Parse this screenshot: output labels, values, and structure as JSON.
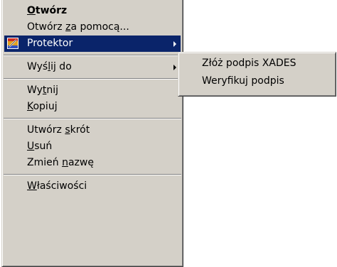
{
  "menu": {
    "items": [
      {
        "pre": "",
        "key": "O",
        "post": "twórz",
        "bold": true
      },
      {
        "pre": "Otwórz ",
        "key": "z",
        "post": "a pomocą..."
      },
      {
        "pre": "",
        "key": "",
        "post": "Protektor",
        "selected": true,
        "icon": "protektor-app-icon"
      },
      {
        "pre": "Wyś",
        "key": "l",
        "post": "ij do"
      },
      {
        "pre": "Wy",
        "key": "t",
        "post": "nij"
      },
      {
        "pre": "",
        "key": "K",
        "post": "opiuj"
      },
      {
        "pre": "Utwórz ",
        "key": "s",
        "post": "krót"
      },
      {
        "pre": "",
        "key": "U",
        "post": "suń"
      },
      {
        "pre": "Zmień ",
        "key": "n",
        "post": "azwę"
      },
      {
        "pre": "",
        "key": "W",
        "post": "łaściwości"
      }
    ]
  },
  "submenu": {
    "items": [
      {
        "label": "Złóż podpis XADES"
      },
      {
        "label": "Weryfikuj podpis"
      }
    ]
  },
  "colors": {
    "menu_bg": "#d4d0c8",
    "highlight": "#0a246a"
  }
}
